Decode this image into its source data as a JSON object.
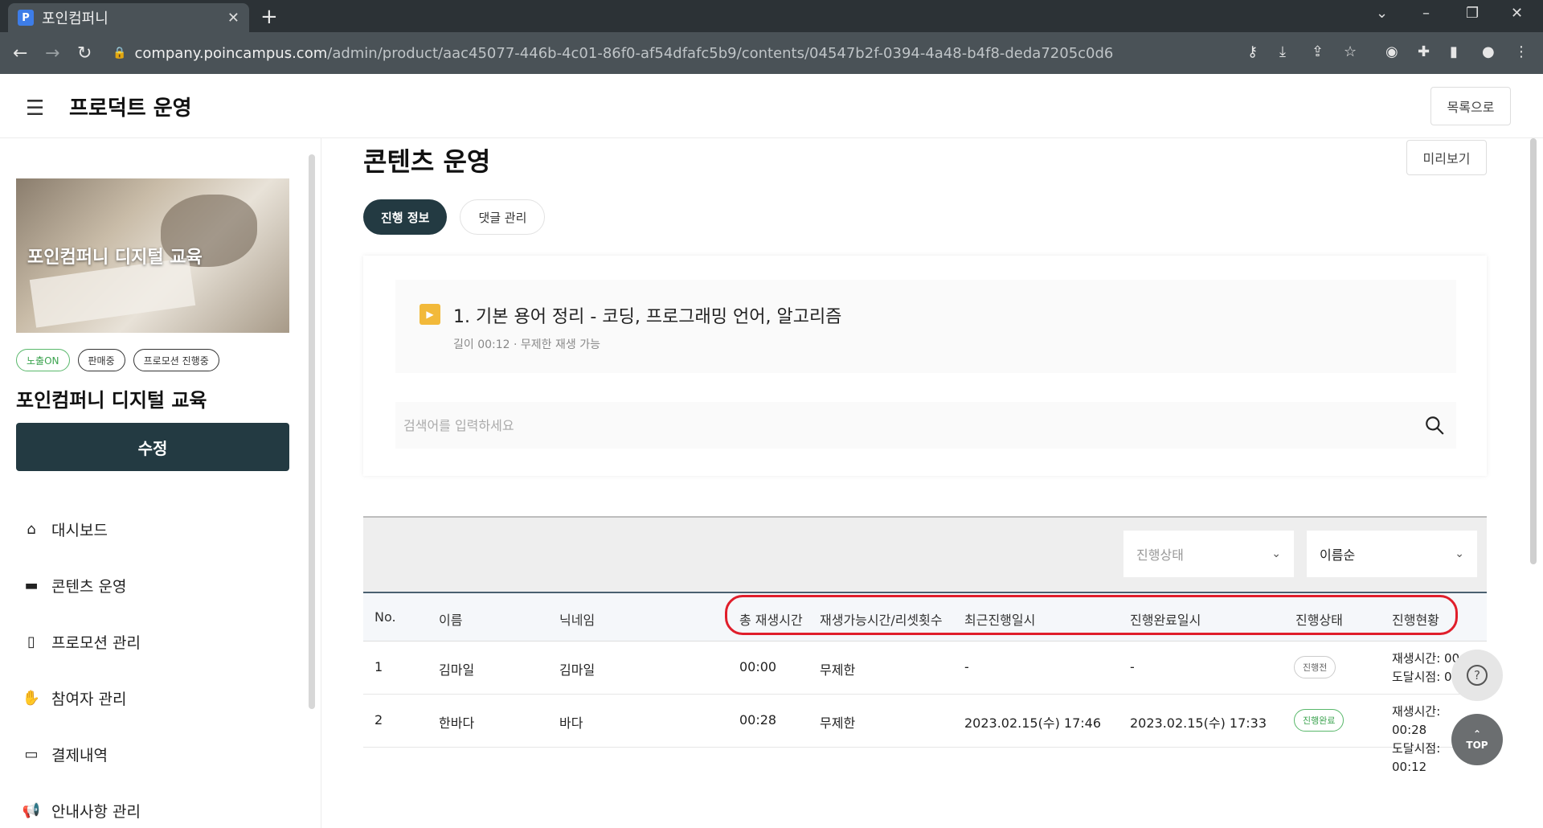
{
  "browser": {
    "tab_title": "포인컴퍼니",
    "favicon_letter": "P",
    "url_host": "company.poincampus.com",
    "url_path": "/admin/product/aac45077-446b-4c01-86f0-af54dfafc5b9/contents/04547b2f-0394-4a48-b4f8-deda7205c0d6"
  },
  "header": {
    "title": "프로덕트 운영",
    "back_label": "목록으로"
  },
  "sidebar": {
    "thumbnail_text": "포인컴퍼니 디지털 교육",
    "badges": [
      "노출ON",
      "판매중",
      "프로모션 진행중"
    ],
    "product_name": "포인컴퍼니 디지털 교육",
    "edit_label": "수정",
    "menu": [
      {
        "label": "대시보드",
        "icon": "home-icon"
      },
      {
        "label": "콘텐츠 운영",
        "icon": "folder-icon"
      },
      {
        "label": "프로모션 관리",
        "icon": "promotion-icon"
      },
      {
        "label": "참여자 관리",
        "icon": "hand-icon"
      },
      {
        "label": "결제내역",
        "icon": "card-icon"
      },
      {
        "label": "안내사항 관리",
        "icon": "megaphone-icon"
      }
    ]
  },
  "main": {
    "title": "콘텐츠 운영",
    "preview_label": "미리보기",
    "tabs": [
      {
        "label": "진행 정보",
        "active": true
      },
      {
        "label": "댓글 관리",
        "active": false
      }
    ],
    "content": {
      "title": "1. 기본 용어 정리 - 코딩, 프로그래밍 언어, 알고리즘",
      "meta": "길이 00:12 · 무제한 재생 가능"
    },
    "search": {
      "placeholder": "검색어를 입력하세요",
      "value": ""
    },
    "filters": {
      "status_placeholder": "진행상태",
      "sort_value": "이름순"
    },
    "table": {
      "columns": [
        "No.",
        "이름",
        "닉네임",
        "총 재생시간",
        "재생가능시간/리셋횟수",
        "최근진행일시",
        "진행완료일시",
        "진행상태",
        "진행현황"
      ],
      "rows": [
        {
          "no": "1",
          "name": "김마일",
          "nickname": "김마일",
          "total": "00:00",
          "limit": "무제한",
          "recent": "-",
          "completed": "-",
          "status": "진행전",
          "status_done": false,
          "progress_1": "재생시간: 00:",
          "progress_2": "도달시점: 0"
        },
        {
          "no": "2",
          "name": "한바다",
          "nickname": "바다",
          "total": "00:28",
          "limit": "무제한",
          "recent": "2023.02.15(수) 17:46",
          "completed": "2023.02.15(수) 17:33",
          "status": "진행완료",
          "status_done": true,
          "progress_1": "재생시간: 00:28",
          "progress_2": "도달시점: 00:12"
        }
      ]
    }
  },
  "floating": {
    "help_icon": "question-icon",
    "top_label": "TOP"
  },
  "colors": {
    "primary": "#233a42",
    "highlight": "#e01e2b",
    "accent_green": "#3ba34f",
    "play_icon": "#f2b93a"
  }
}
